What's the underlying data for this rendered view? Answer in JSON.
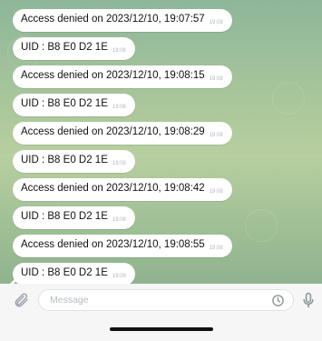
{
  "messages": [
    {
      "text": "Access denied on 2023/12/10, 19:07:57",
      "time": "19:08"
    },
    {
      "text": "UID : B8 E0 D2 1E",
      "time": "19:08"
    },
    {
      "text": "Access denied on 2023/12/10, 19:08:15",
      "time": "19:08"
    },
    {
      "text": "UID : B8 E0 D2 1E",
      "time": "19:08"
    },
    {
      "text": "Access denied on 2023/12/10, 19:08:29",
      "time": "19:08"
    },
    {
      "text": "UID : B8 E0 D2 1E",
      "time": "19:08"
    },
    {
      "text": "Access denied on 2023/12/10, 19:08:42",
      "time": "19:08"
    },
    {
      "text": "UID : B8 E0 D2 1E",
      "time": "19:08"
    },
    {
      "text": "Access denied on 2023/12/10, 19:08:55",
      "time": "19:08"
    },
    {
      "text": "UID : B8 E0 D2 1E",
      "time": "19:09"
    }
  ],
  "input": {
    "placeholder": "Message"
  },
  "icons": {
    "attach": "paperclip-icon",
    "sticker": "sticker-clock-icon",
    "mic": "microphone-icon"
  },
  "colors": {
    "chat_background": "#a8c69a",
    "bubble": "#ffffff",
    "input_bar": "#f6f6f6"
  }
}
